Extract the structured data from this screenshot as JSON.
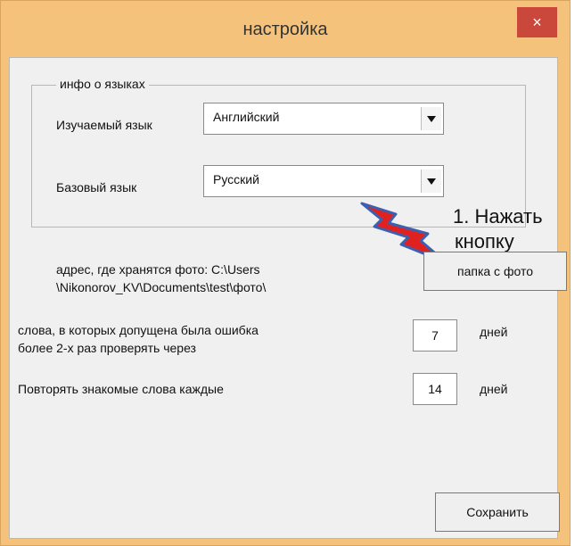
{
  "window": {
    "title": "настройка",
    "close_glyph": "×"
  },
  "languages": {
    "group_title": "инфо о языках",
    "studied_label": "Изучаемый язык",
    "studied_value": "Английский",
    "base_label": "Базовый язык",
    "base_value": "Русский"
  },
  "photos": {
    "path_text_line1": "адрес, где хранятся фото: C:\\Users",
    "path_text_line2": "\\Nikonorov_KV\\Documents\\test\\фото\\",
    "folder_button": "папка с фото"
  },
  "errors_setting": {
    "label_line1": "слова, в которых допущена была ошибка",
    "label_line2": "более 2-х раз проверять через",
    "value": "7",
    "unit": "дней"
  },
  "repeat_setting": {
    "label": "Повторять знакомые слова каждые",
    "value": "14",
    "unit": "дней"
  },
  "save_button": "Сохранить",
  "annotation": {
    "line1": "1. Нажать",
    "line2": "кнопку"
  },
  "colors": {
    "frame": "#f4c27a",
    "close": "#c9473b",
    "bolt": "#e1211f",
    "bolt_outline": "#3d5fb0"
  }
}
